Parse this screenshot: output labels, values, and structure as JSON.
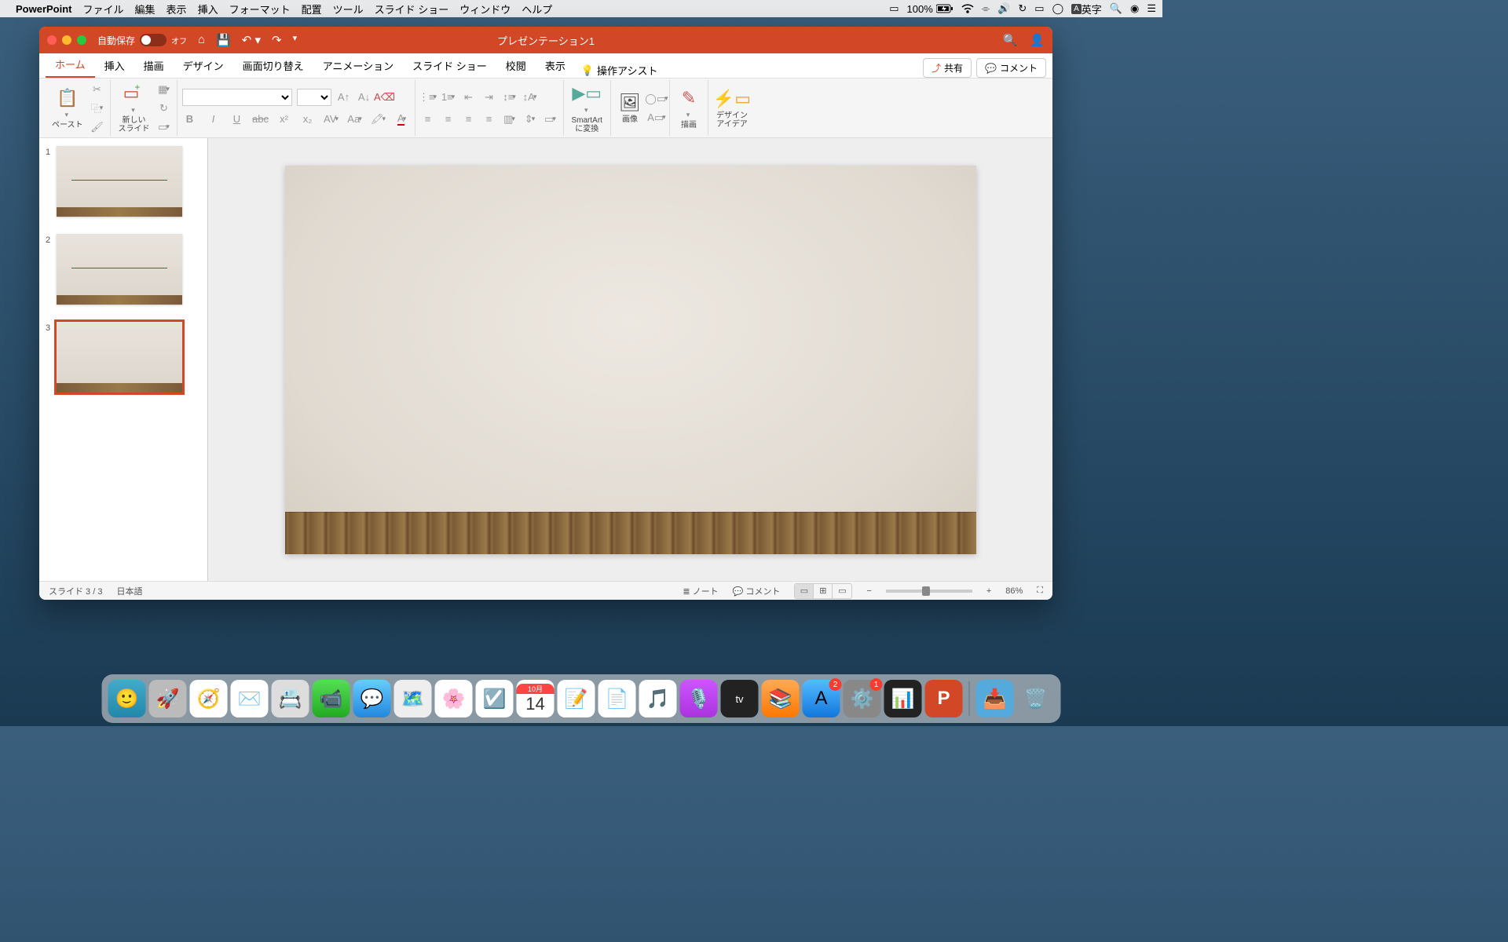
{
  "menubar": {
    "app_name": "PowerPoint",
    "items": [
      "ファイル",
      "編集",
      "表示",
      "挿入",
      "フォーマット",
      "配置",
      "ツール",
      "スライド ショー",
      "ウィンドウ",
      "ヘルプ"
    ],
    "battery": "100%",
    "input": "英字"
  },
  "titlebar": {
    "autosave_label": "自動保存",
    "autosave_state": "オフ",
    "title": "プレゼンテーション1"
  },
  "tabs": {
    "items": [
      "ホーム",
      "挿入",
      "描画",
      "デザイン",
      "画面切り替え",
      "アニメーション",
      "スライド ショー",
      "校閲",
      "表示"
    ],
    "active_index": 0,
    "assist": "操作アシスト",
    "share": "共有",
    "comment": "コメント"
  },
  "ribbon": {
    "paste": "ペースト",
    "new_slide": "新しい\nスライド",
    "smartart": "SmartArt\nに変換",
    "image": "画像",
    "drawing": "描画",
    "design_ideas": "デザイン\nアイデア"
  },
  "slides": {
    "count": 3,
    "selected": 3
  },
  "statusbar": {
    "slide_label": "スライド 3 / 3",
    "language": "日本語",
    "notes": "ノート",
    "comments": "コメント",
    "zoom": "86%"
  },
  "dock": {
    "calendar_month": "10月",
    "calendar_day": "14",
    "appstore_badge": "2",
    "sysprefs_badge": "1"
  }
}
